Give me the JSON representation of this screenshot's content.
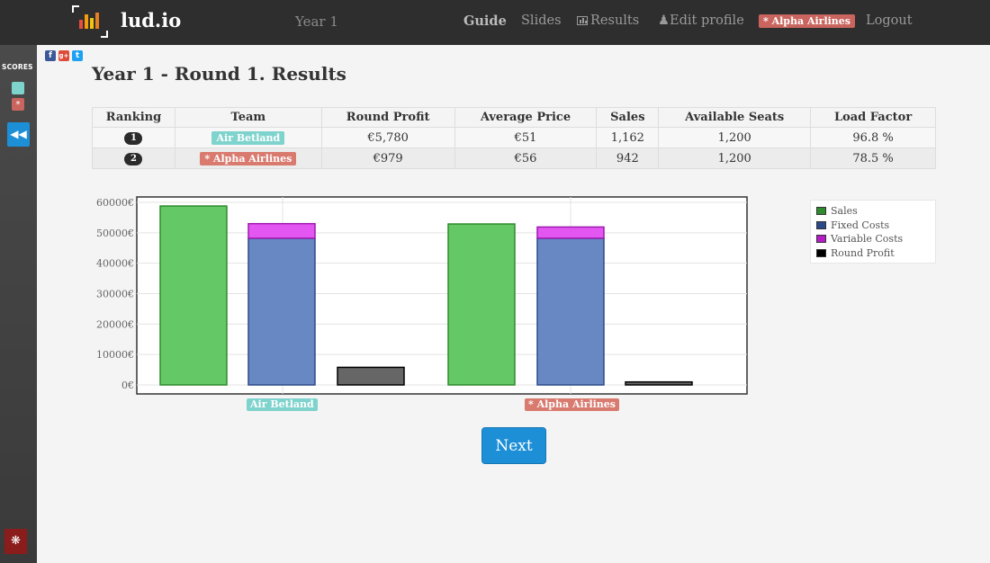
{
  "colors": {
    "team1": "#7fd3cd",
    "team2": "#d97a6f",
    "sales": "#64c867",
    "fixed": "#6788c2",
    "variable": "#e356f2",
    "profit": "#666666",
    "primary": "#1c8fd6"
  },
  "header": {
    "brand": "lud.io",
    "year": "Year 1",
    "nav": {
      "guide": "Guide",
      "slides": "Slides",
      "results": "Results",
      "edit_profile": "Edit profile",
      "team_badge": "* Alpha Airlines",
      "logout": "Logout"
    }
  },
  "sidebar": {
    "scores_label": "SCORES",
    "team_square_1": "",
    "team_square_2": "*",
    "collapse_icon": "double-chevron-left-icon",
    "bug_icon": "bug-icon"
  },
  "social": {
    "facebook": "f",
    "google": "g+",
    "twitter": "t"
  },
  "page": {
    "title": "Year 1 - Round 1. Results"
  },
  "table": {
    "headers": [
      "Ranking",
      "Team",
      "Round Profit",
      "Average Price",
      "Sales",
      "Available Seats",
      "Load Factor"
    ],
    "rows": [
      {
        "rank": "1",
        "team": "Air Betland",
        "profit": "€5,780",
        "price": "€51",
        "sales": "1,162",
        "seats": "1,200",
        "load": "96.8 %"
      },
      {
        "rank": "2",
        "team": "* Alpha Airlines",
        "profit": "€979",
        "price": "€56",
        "sales": "942",
        "seats": "1,200",
        "load": "78.5 %"
      }
    ]
  },
  "chart_data": {
    "type": "bar",
    "categories": [
      "Air Betland",
      "* Alpha Airlines"
    ],
    "series": [
      {
        "name": "Sales",
        "values": [
          58800,
          52900
        ]
      },
      {
        "name": "Fixed Costs",
        "values": [
          48200,
          48200
        ]
      },
      {
        "name": "Variable Costs",
        "values": [
          4800,
          3700
        ]
      },
      {
        "name": "Round Profit",
        "values": [
          5780,
          979
        ]
      }
    ],
    "stacked_pair": [
      "Fixed Costs",
      "Variable Costs"
    ],
    "yticks": [
      "0€",
      "10000€",
      "20000€",
      "30000€",
      "40000€",
      "50000€",
      "60000€"
    ],
    "ylim": [
      0,
      60000
    ],
    "grid": true,
    "legend": "right"
  },
  "footer": {
    "next_label": "Next"
  }
}
